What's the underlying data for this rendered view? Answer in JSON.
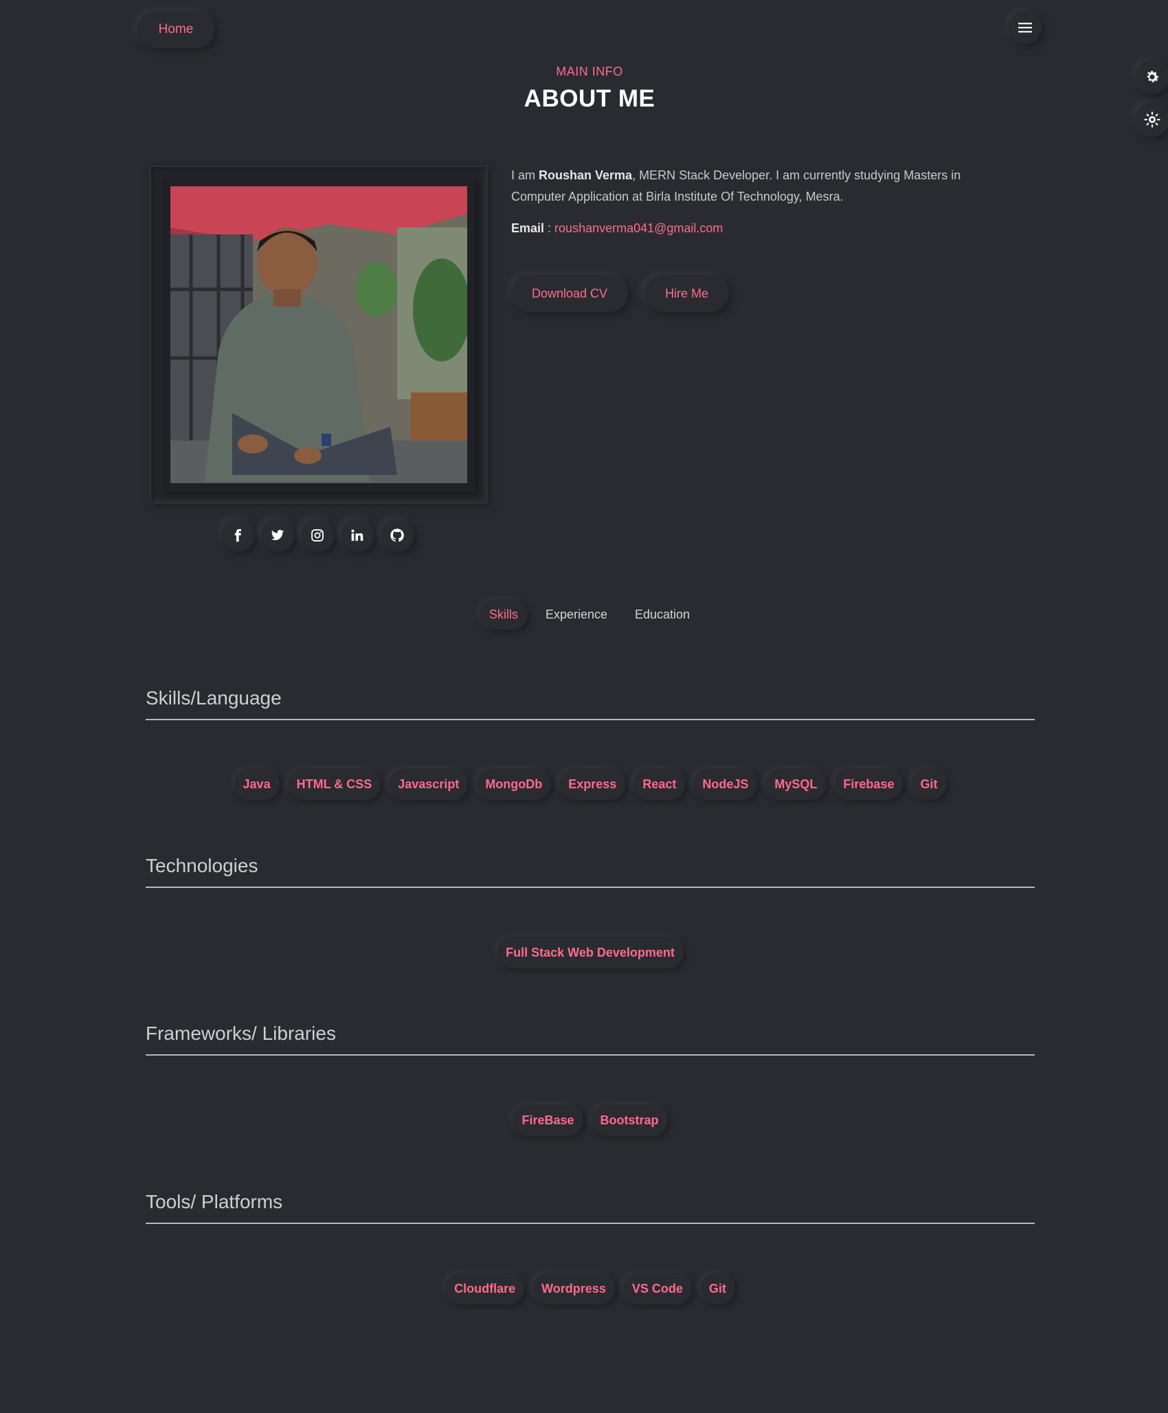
{
  "nav": {
    "home_label": "Home"
  },
  "header": {
    "kicker": "MAIN INFO",
    "title": "ABOUT ME"
  },
  "about": {
    "intro_prefix": "I am ",
    "name": "Roushan Verma",
    "intro_suffix": ", MERN Stack Developer. I am currently studying Masters in Computer Application at Birla Institute Of Technology, Mesra.",
    "email_label": "Email",
    "email_sep": " : ",
    "email": "roushanverma041@gmail.com",
    "download_label": "Download CV",
    "hire_label": "Hire Me"
  },
  "social": [
    "facebook-icon",
    "twitter-icon",
    "instagram-icon",
    "linkedin-icon",
    "github-icon"
  ],
  "tabs": [
    {
      "label": "Skills",
      "active": true
    },
    {
      "label": "Experience",
      "active": false
    },
    {
      "label": "Education",
      "active": false
    }
  ],
  "sections": {
    "languages": {
      "title": "Skills/Language",
      "items": [
        "Java",
        "HTML & CSS",
        "Javascript",
        "MongoDb",
        "Express",
        "React",
        "NodeJS",
        "MySQL",
        "Firebase",
        "Git"
      ]
    },
    "technologies": {
      "title": "Technologies",
      "items": [
        "Full Stack Web Development"
      ]
    },
    "frameworks": {
      "title": "Frameworks/ Libraries",
      "items": [
        "FireBase",
        "Bootstrap"
      ]
    },
    "tools": {
      "title": "Tools/ Platforms",
      "items": [
        "Cloudflare",
        "Wordpress",
        "VS Code",
        "Git"
      ]
    }
  },
  "colors": {
    "accent": "#ff6b8b",
    "background": "#2a2b30"
  }
}
